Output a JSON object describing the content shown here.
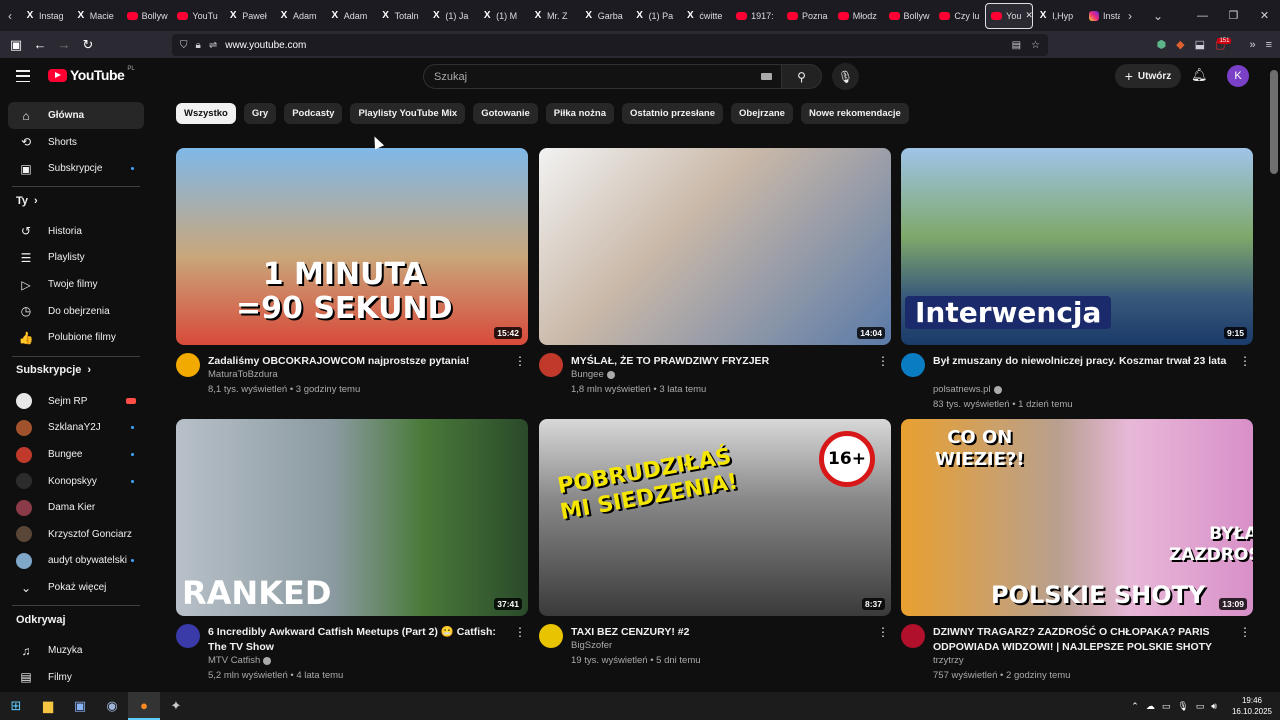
{
  "browser": {
    "tabs": [
      {
        "icon": "x",
        "label": "Instag"
      },
      {
        "icon": "x",
        "label": "Macie"
      },
      {
        "icon": "yt",
        "label": "Bollyw"
      },
      {
        "icon": "yt",
        "label": "YouTu"
      },
      {
        "icon": "x",
        "label": "Paweł"
      },
      {
        "icon": "x",
        "label": "Adam"
      },
      {
        "icon": "x",
        "label": "Adam"
      },
      {
        "icon": "x",
        "label": "Totaln"
      },
      {
        "icon": "x",
        "label": "(1) Ja"
      },
      {
        "icon": "x",
        "label": "(1) M"
      },
      {
        "icon": "x",
        "label": "Mr. Z"
      },
      {
        "icon": "x",
        "label": "Garba"
      },
      {
        "icon": "x",
        "label": "(1) Pa"
      },
      {
        "icon": "x",
        "label": "ćwitte"
      },
      {
        "icon": "yt",
        "label": "1917:"
      },
      {
        "icon": "yt",
        "label": "Pozna"
      },
      {
        "icon": "yt",
        "label": "Młodz"
      },
      {
        "icon": "yt",
        "label": "Bollyw"
      },
      {
        "icon": "yt",
        "label": "Czy lu"
      },
      {
        "icon": "yt",
        "label": "You",
        "active": true
      },
      {
        "icon": "x",
        "label": "I,Hyp"
      },
      {
        "icon": "ig",
        "label": "Instag"
      }
    ],
    "url": "www.youtube.com",
    "notif_count": "151"
  },
  "header": {
    "logo_text": "YouTube",
    "logo_country": "PL",
    "search_placeholder": "Szukaj",
    "create_label": "Utwórz",
    "avatar_letter": "K"
  },
  "sidebar": {
    "main": [
      {
        "label": "Główna",
        "icon": "home-icon",
        "glyph": "⌂",
        "active": true
      },
      {
        "label": "Shorts",
        "icon": "shorts-icon",
        "glyph": "⟲"
      },
      {
        "label": "Subskrypcje",
        "icon": "subscriptions-icon",
        "glyph": "▣",
        "dot": true
      }
    ],
    "you_title": "Ty",
    "you": [
      {
        "label": "Historia",
        "icon": "history-icon",
        "glyph": "↺"
      },
      {
        "label": "Playlisty",
        "icon": "playlists-icon",
        "glyph": "☰"
      },
      {
        "label": "Twoje filmy",
        "icon": "your-videos-icon",
        "glyph": "▷"
      },
      {
        "label": "Do obejrzenia",
        "icon": "watch-later-icon",
        "glyph": "◷"
      },
      {
        "label": "Polubione filmy",
        "icon": "liked-icon",
        "glyph": "👍"
      }
    ],
    "subs_title": "Subskrypcje",
    "subs": [
      {
        "label": "Sejm RP",
        "color": "#e8e8e8",
        "live": true
      },
      {
        "label": "SzklanaY2J",
        "color": "#a0522d",
        "dot": true
      },
      {
        "label": "Bungee",
        "color": "#c0392b",
        "dot": true
      },
      {
        "label": "Konopskyy",
        "color": "#2c2c2c",
        "dot": true
      },
      {
        "label": "Dama Kier",
        "color": "#8b3a4a"
      },
      {
        "label": "Krzysztof Gonciarz",
        "color": "#5a4636"
      },
      {
        "label": "audyt obywatelski",
        "color": "#7fa7c9",
        "dot": true
      }
    ],
    "show_more": "Pokaż więcej",
    "explore_title": "Odkrywaj",
    "explore": [
      {
        "label": "Muzyka",
        "icon": "music-icon",
        "glyph": "♫"
      },
      {
        "label": "Filmy",
        "icon": "movies-icon",
        "glyph": "▤"
      }
    ]
  },
  "chips": [
    "Wszystko",
    "Gry",
    "Podcasty",
    "Playlisty YouTube Mix",
    "Gotowanie",
    "Piłka nożna",
    "Ostatnio przesłane",
    "Obejrzane",
    "Nowe rekomendacje"
  ],
  "videos": [
    {
      "title": "Zadaliśmy OBCOKRAJOWCOM najprostsze pytania!",
      "channel": "MaturaToBzdura",
      "verified": false,
      "stats": "8,1 tys. wyświetleń • 3 godziny temu",
      "duration": "15:42",
      "thumb_text": "1 MINUTA\n=90 SEKUND",
      "avatar_color": "#f2a900"
    },
    {
      "title": "MYŚLAŁ, ŻE TO PRAWDZIWY FRYZJER",
      "channel": "Bungee",
      "verified": true,
      "stats": "1,8 mln wyświetleń • 3 lata temu",
      "duration": "14:04",
      "thumb_text": "",
      "avatar_color": "#c0392b"
    },
    {
      "title": "Był zmuszany do niewolniczej pracy. Koszmar trwał 23 lata",
      "channel": "polsatnews.pl",
      "verified": true,
      "stats": "83 tys. wyświetleń • 1 dzień temu",
      "duration": "9:15",
      "thumb_text": "Interwencja",
      "avatar_color": "#0a7cc1"
    },
    {
      "title": "6 Incredibly Awkward Catfish Meetups (Part 2) 😬 Catfish: The TV Show",
      "channel": "MTV Catfish",
      "verified": true,
      "stats": "5,2 mln wyświetleń • 4 lata temu",
      "duration": "37:41",
      "thumb_text": "RANKED",
      "avatar_color": "#3a3aa8"
    },
    {
      "title": "TAXI BEZ CENZURY! #2",
      "channel": "BigSzofer",
      "verified": false,
      "stats": "19 tys. wyświetleń • 5 dni temu",
      "duration": "8:37",
      "thumb_text": "POBRUDZIŁAŚ\nMI SIEDZENIA!",
      "badge": "16+",
      "avatar_color": "#e8c400"
    },
    {
      "title": "DZIWNY TRAGARZ? ZAZDROŚĆ O CHŁOPAKA? PARIS ODPOWIADA WIDZOWI! | NAJLEPSZE POLSKIE SHOTY",
      "channel": "trzytrzy",
      "verified": false,
      "stats": "757 wyświetleń • 2 godziny temu",
      "duration": "13:09",
      "thumb_text": "POLSKIE SHOTY",
      "thumb_top": "CO ON\nWIEZIE?!",
      "thumb_side": "BYŁA\nZAZDROSNA?",
      "avatar_color": "#b0102a"
    }
  ],
  "taskbar": {
    "time": "19:46",
    "date": "16.10.2025"
  }
}
